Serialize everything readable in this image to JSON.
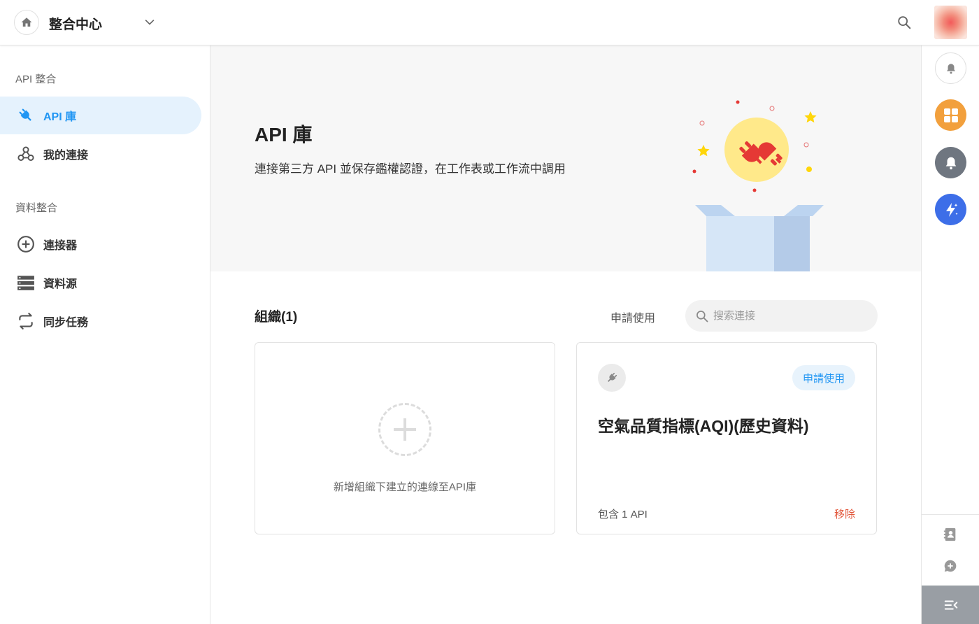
{
  "header": {
    "title": "整合中心"
  },
  "sidebar": {
    "section_api": "API 整合",
    "items_api": [
      {
        "label": "API 庫",
        "icon": "plug-icon",
        "active": true
      },
      {
        "label": "我的連接",
        "icon": "webhook-icon",
        "active": false
      }
    ],
    "section_data": "資料整合",
    "items_data": [
      {
        "label": "連接器",
        "icon": "add-circle-icon"
      },
      {
        "label": "資料源",
        "icon": "storage-icon"
      },
      {
        "label": "同步任務",
        "icon": "sync-icon"
      }
    ]
  },
  "hero": {
    "title": "API 庫",
    "subtitle": "連接第三方 API 並保存鑑權認證，在工作表或工作流中調用"
  },
  "org": {
    "title": "組織(1)",
    "apply_label": "申請使用",
    "search_placeholder": "搜索連接"
  },
  "add_card": {
    "text": "新增組織下建立的連線至API庫"
  },
  "api_card": {
    "badge": "申請使用",
    "name": "空氣品質指標(AQI)(歷史資料)",
    "count": "包含 1 API",
    "remove": "移除"
  },
  "colors": {
    "accent": "#2196f3",
    "active_bg": "#e5f2fd",
    "rail_orange": "#f2a03d",
    "rail_gray": "#6f7680",
    "rail_blue": "#3d6ee8",
    "remove_red": "#e2573b"
  }
}
